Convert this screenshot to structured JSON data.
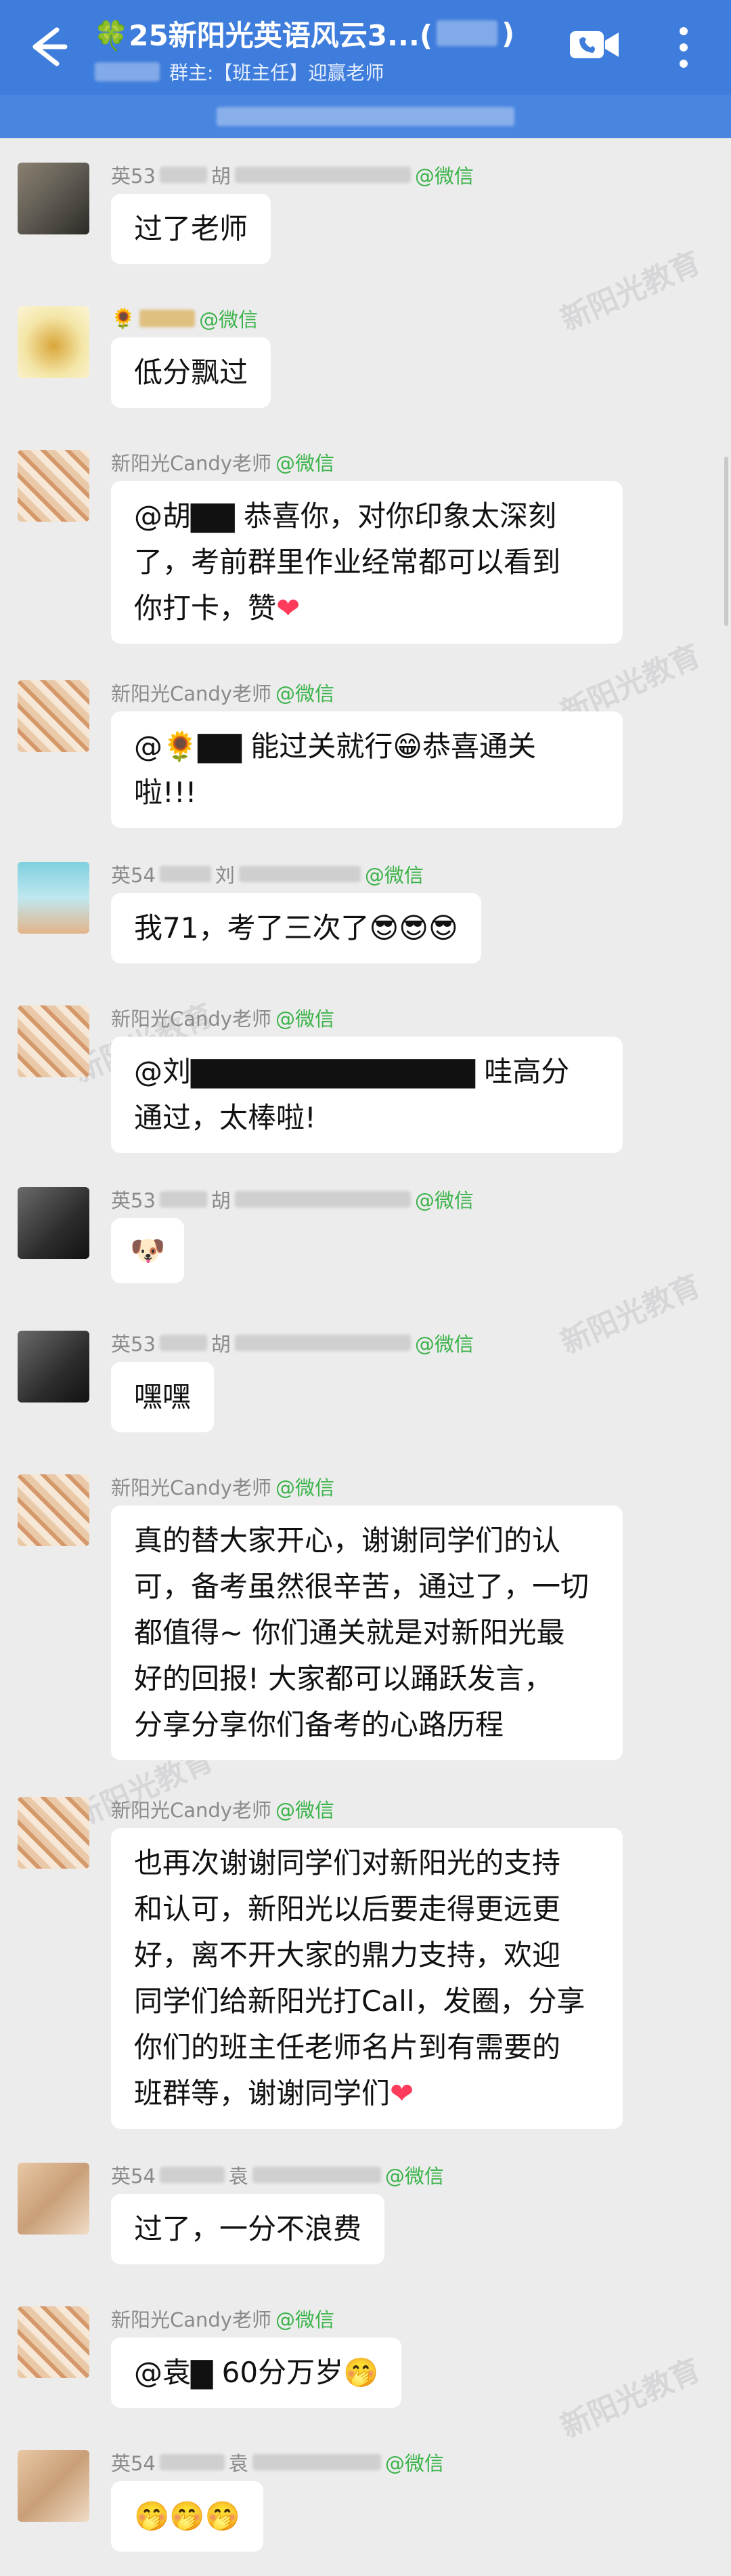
{
  "header": {
    "title": "🍀25新阳光英语风云3...(",
    "title_suffix": ")",
    "owner_label": "群主:【班主任】迎赢老师"
  },
  "watermark_text": "新阳光教育",
  "messages": [
    {
      "sender_prefix": "英53",
      "sender_mid": "胡",
      "tag": "@微信",
      "lines": [
        "过了老师"
      ]
    },
    {
      "sender_prefix": "🌻",
      "sender_mid": "",
      "tag": "@微信",
      "lines": [
        "低分飘过"
      ]
    },
    {
      "sender_prefix": "新阳光Candy老师",
      "sender_mid": "",
      "tag": "@微信",
      "lines": [
        "@胡▇▇ 恭喜你，对你印象太深刻",
        "了，考前群里作业经常都可以看到",
        "你打卡，赞"
      ]
    },
    {
      "sender_prefix": "新阳光Candy老师",
      "sender_mid": "",
      "tag": "@微信",
      "lines": [
        "@🌻▇▇ 能过关就行😁恭喜通关",
        "啦!!!"
      ]
    },
    {
      "sender_prefix": "英54",
      "sender_mid": "刘",
      "tag": "@微信",
      "lines": [
        "我71，考了三次了😎😎😎"
      ]
    },
    {
      "sender_prefix": "新阳光Candy老师",
      "sender_mid": "",
      "tag": "@微信",
      "lines": [
        "@刘▇▇▇▇▇▇▇▇▇▇▇▇▇ 哇高分",
        "通过，太棒啦!"
      ]
    },
    {
      "sender_prefix": "英53",
      "sender_mid": "胡",
      "tag": "@微信",
      "lines": [
        "🐶"
      ]
    },
    {
      "sender_prefix": "英53",
      "sender_mid": "胡",
      "tag": "@微信",
      "lines": [
        "嘿嘿"
      ]
    },
    {
      "sender_prefix": "新阳光Candy老师",
      "sender_mid": "",
      "tag": "@微信",
      "lines": [
        "真的替大家开心，谢谢同学们的认",
        "可，备考虽然很辛苦，通过了，一切",
        "都值得~ 你们通关就是对新阳光最",
        "好的回报! 大家都可以踊跃发言，",
        "分享分享你们备考的心路历程"
      ]
    },
    {
      "sender_prefix": "新阳光Candy老师",
      "sender_mid": "",
      "tag": "@微信",
      "lines": [
        "也再次谢谢同学们对新阳光的支持",
        "和认可，新阳光以后要走得更远更",
        "好，离不开大家的鼎力支持，欢迎",
        "同学们给新阳光打Call，发圈，分享",
        "你们的班主任老师名片到有需要的",
        "班群等，谢谢同学们"
      ]
    },
    {
      "sender_prefix": "英54",
      "sender_mid": "袁",
      "tag": "@微信",
      "lines": [
        "过了，一分不浪费"
      ]
    },
    {
      "sender_prefix": "新阳光Candy老师",
      "sender_mid": "",
      "tag": "@微信",
      "lines": [
        "@袁▇ 60分万岁🤭"
      ]
    },
    {
      "sender_prefix": "英54",
      "sender_mid": "袁",
      "tag": "@微信",
      "lines": [
        "🤭🤭🤭"
      ]
    }
  ]
}
